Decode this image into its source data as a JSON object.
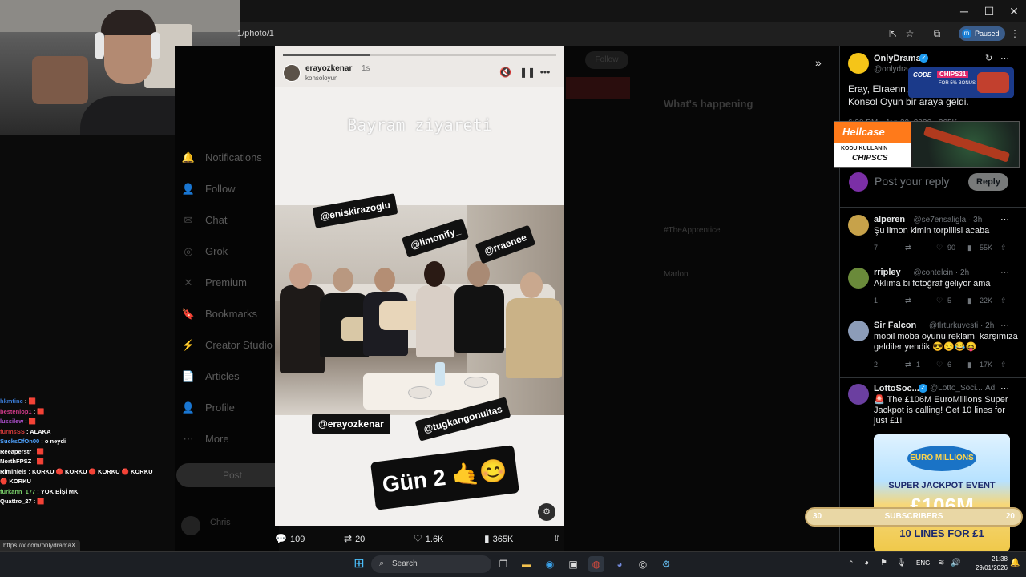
{
  "browser": {
    "url_fragment": "1/photo/1",
    "profile_initial": "m",
    "profile_status": "Paused",
    "status_url": "https://x.com/onlydramaX"
  },
  "xnav": {
    "items": [
      {
        "label": "Notifications",
        "icon": "bell-icon",
        "glyph": "🔔"
      },
      {
        "label": "Follow",
        "icon": "person-add-icon",
        "glyph": "👤"
      },
      {
        "label": "Chat",
        "icon": "mail-icon",
        "glyph": "✉"
      },
      {
        "label": "Grok",
        "icon": "grok-icon",
        "glyph": "◎"
      },
      {
        "label": "Premium",
        "icon": "x-logo-icon",
        "glyph": "✕"
      },
      {
        "label": "Bookmarks",
        "icon": "bookmark-icon",
        "glyph": "🔖"
      },
      {
        "label": "Creator Studio",
        "icon": "creator-icon",
        "glyph": "⚡"
      },
      {
        "label": "Articles",
        "icon": "articles-icon",
        "glyph": "📄"
      },
      {
        "label": "Profile",
        "icon": "profile-icon",
        "glyph": "👤"
      },
      {
        "label": "More",
        "icon": "more-icon",
        "glyph": "⋯"
      }
    ],
    "post_label": "Post",
    "follow_label": "Follow"
  },
  "middle": {
    "whats_happening": "What's happening",
    "trends": [
      "#TheApprentice",
      "Marlon"
    ]
  },
  "story": {
    "username": "erayozkenar",
    "age": "1s",
    "sub": "konsoloyun",
    "headline": "Bayram ziyareti",
    "tags": [
      "@eniskirazoglu",
      "@limonify_",
      "@rraenee",
      "@erayozkenar",
      "@tugkangonultas"
    ],
    "gun_text": "Gün 2 🤙😊"
  },
  "stats": {
    "replies": "109",
    "reposts": "20",
    "likes": "1.6K",
    "views": "365K"
  },
  "post": {
    "name": "OnlyDrama",
    "handle": "@onlydra",
    "text_line1": "Eray, Elraenn, P",
    "text_line2": "Konsol Oyun bir araya geldi.",
    "time": "6:30 PM · Jan 29, 2026 · 365K",
    "reply_placeholder": "Post your reply",
    "reply_button": "Reply"
  },
  "ads": {
    "code_label": "CODE",
    "code_value": "CHIPS31",
    "bonus": "FOR 5% BONUS",
    "hellcase": "Hellcase",
    "kodu": "KODU KULLANIN",
    "chipscs": "CHIPSCS"
  },
  "replies": [
    {
      "name": "alperen",
      "handle": "@se7ensaligla · 3h",
      "text": "Şu limon kimin torpillisi acaba",
      "r": "7",
      "rt": "",
      "l": "90",
      "v": "55K",
      "color": "#c7a24a"
    },
    {
      "name": "rripley",
      "handle": "@contelcin · 2h",
      "text": "Aklıma bi fotoğraf geliyor ama",
      "r": "1",
      "rt": "",
      "l": "5",
      "v": "22K",
      "color": "#6a8a3a"
    },
    {
      "name": "Sir Falcon",
      "handle": "@tlrturkuvesti · 2h",
      "text": "mobil moba oyunu reklamı karşımıza geldiler yendik 😎😒😂😝",
      "r": "2",
      "rt": "1",
      "l": "6",
      "v": "17K",
      "color": "#8c9cb8"
    }
  ],
  "lotto": {
    "name": "LottoSoc...",
    "handle": "@Lotto_Soci...",
    "ad": "Ad",
    "text": "🚨 The £106M EuroMillions Super Jackpot is calling! Get 10 lines for just £1!",
    "img_logo": "EURO MILLIONS",
    "img_event": "SUPER JACKPOT EVENT",
    "img_amount": "£106M",
    "img_lines": "10 LINES FOR £1"
  },
  "subs": {
    "left": "30",
    "label": "SUBSCRIBERS",
    "right": "20"
  },
  "chat": [
    {
      "user": "hkmtinc",
      "msg": ": 🟥",
      "color": "#3a7bd5"
    },
    {
      "user": "bestenlop1",
      "msg": ": 🟥",
      "color": "#d23b8a"
    },
    {
      "user": "lussilew",
      "msg": ": 🟥",
      "color": "#b453d6"
    },
    {
      "user": "furmsSS",
      "msg": ": ALAKA",
      "color": "#d43a3a"
    },
    {
      "user": "SucksOfOn00",
      "msg": ": o neydi",
      "color": "#4fa3ff"
    },
    {
      "user": "Reeaperstr",
      "msg": ": 🟥",
      "color": "#ffffff"
    },
    {
      "user": "NorthFPSZ",
      "msg": ": 🟥",
      "color": "#ffffff"
    },
    {
      "user": "Riminiels",
      "msg": ": KORKU 🔴 KORKU 🔴 KORKU 🔴 KORKU",
      "color": "#ffffff"
    },
    {
      "user": "",
      "msg": "🔴 KORKU",
      "color": "#ffffff"
    },
    {
      "user": "furkann_177",
      "msg": ": YOK BİŞİ MK",
      "color": "#7bd36b"
    },
    {
      "user": "Quattro_27",
      "msg": ": 🟥",
      "color": "#ffffff"
    }
  ],
  "taskbar": {
    "search": "Search",
    "lang": "ENG",
    "time": "21:38",
    "date": "29/01/2026"
  }
}
